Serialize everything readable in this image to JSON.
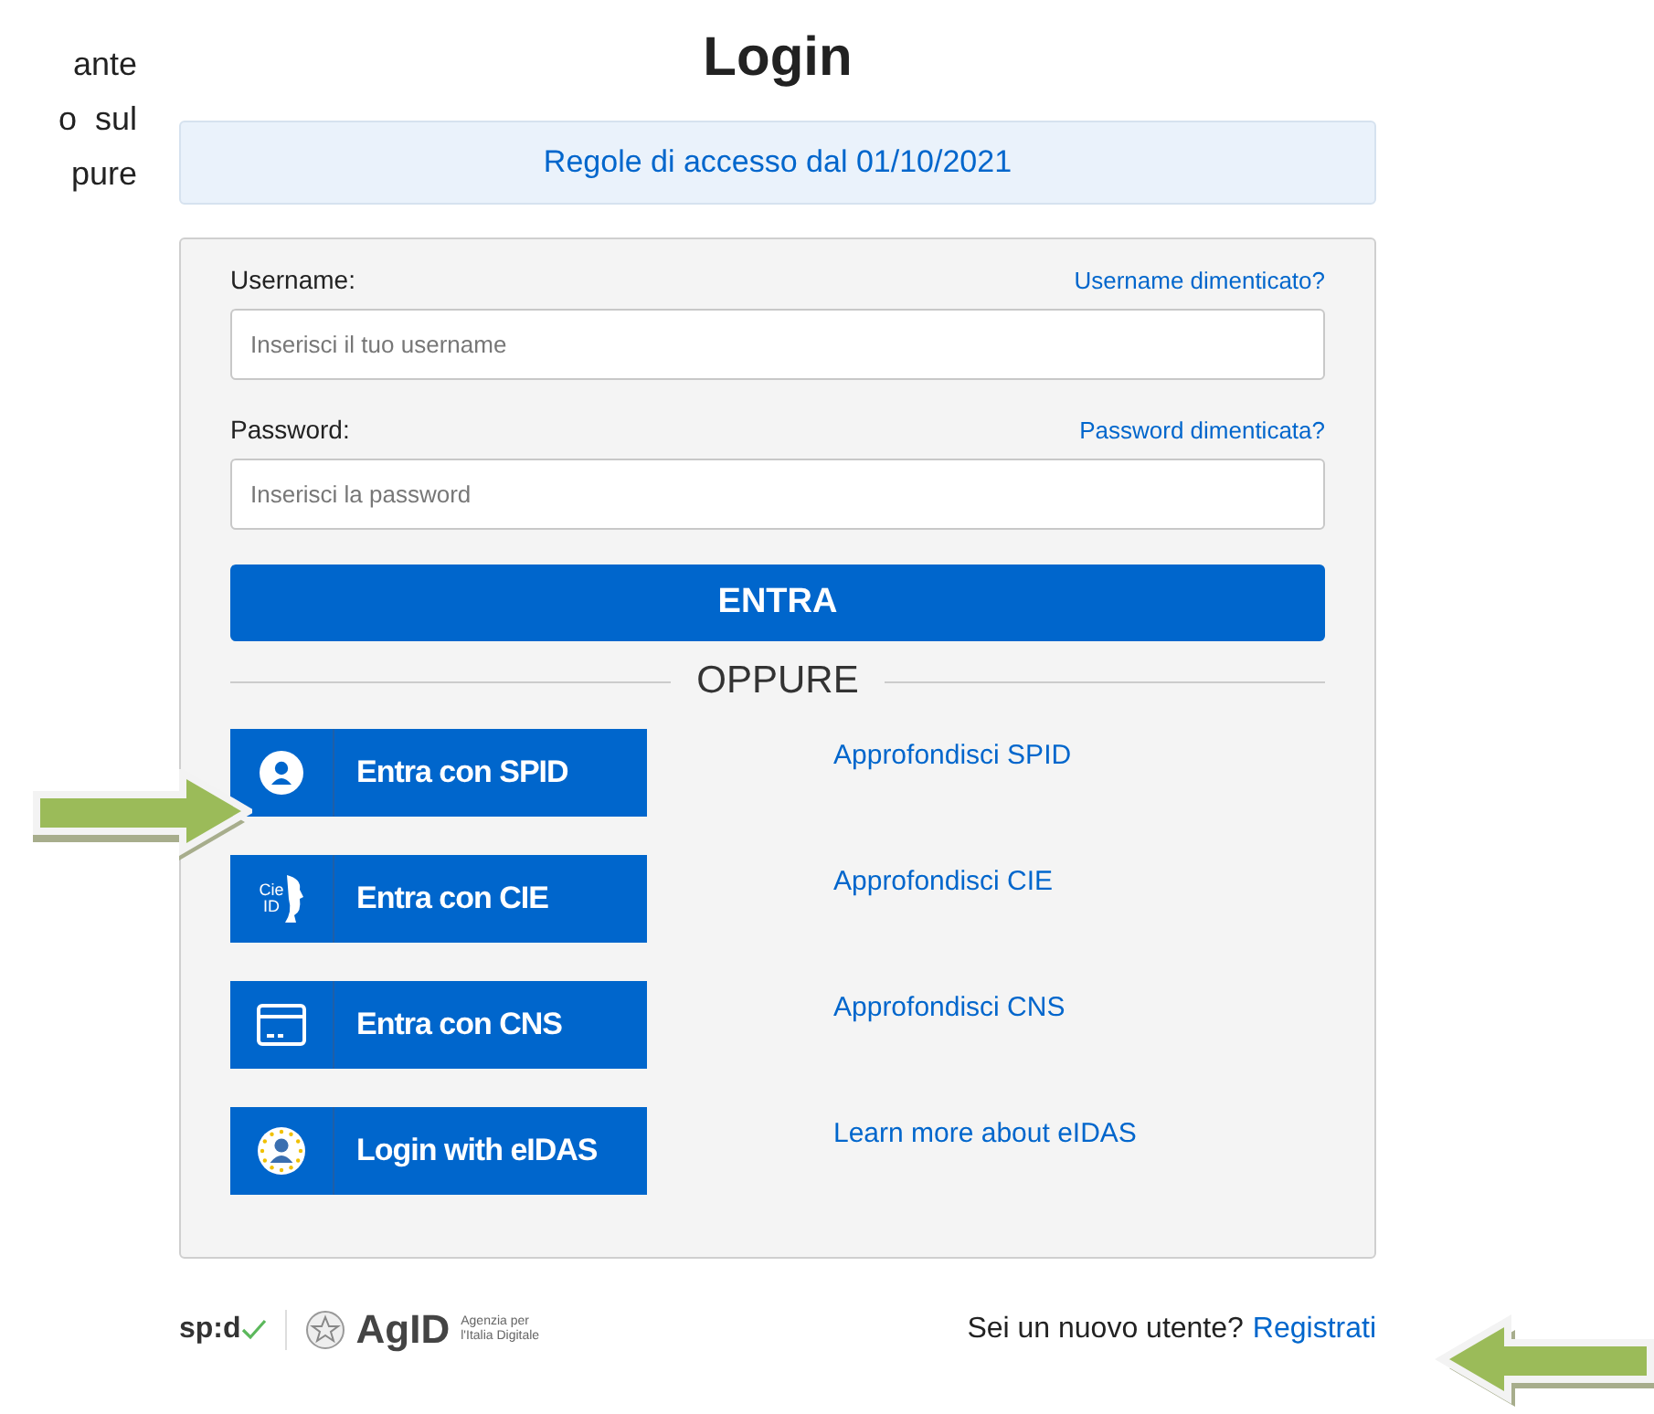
{
  "side_text": [
    "ante",
    "o  sul",
    "pure"
  ],
  "title": "Login",
  "notice": "Regole di accesso dal 01/10/2021",
  "fields": [
    {
      "label": "Username:",
      "link": "Username dimenticato?",
      "placeholder": "Inserisci il tuo username"
    },
    {
      "label": "Password:",
      "link": "Password dimenticata?",
      "placeholder": "Inserisci la password"
    }
  ],
  "submit": "ENTRA",
  "divider": "OPPURE",
  "providers": [
    {
      "kind": "spid",
      "label": "Entra con SPID",
      "link": "Approfondisci SPID"
    },
    {
      "kind": "cie",
      "label": "Entra con CIE",
      "link": "Approfondisci CIE",
      "badge": [
        "Cie",
        "ID"
      ]
    },
    {
      "kind": "cns",
      "label": "Entra con CNS",
      "link": "Approfondisci CNS"
    },
    {
      "kind": "eidas",
      "label": "Login with eIDAS",
      "link": "Learn more about eIDAS"
    }
  ],
  "footer": {
    "spid_logo": "sp:d",
    "agid_logo": "AgID",
    "agid_caption": [
      "Agenzia per",
      "l'Italia Digitale"
    ],
    "question": "Sei un nuovo utente?",
    "register": "Registrati"
  }
}
